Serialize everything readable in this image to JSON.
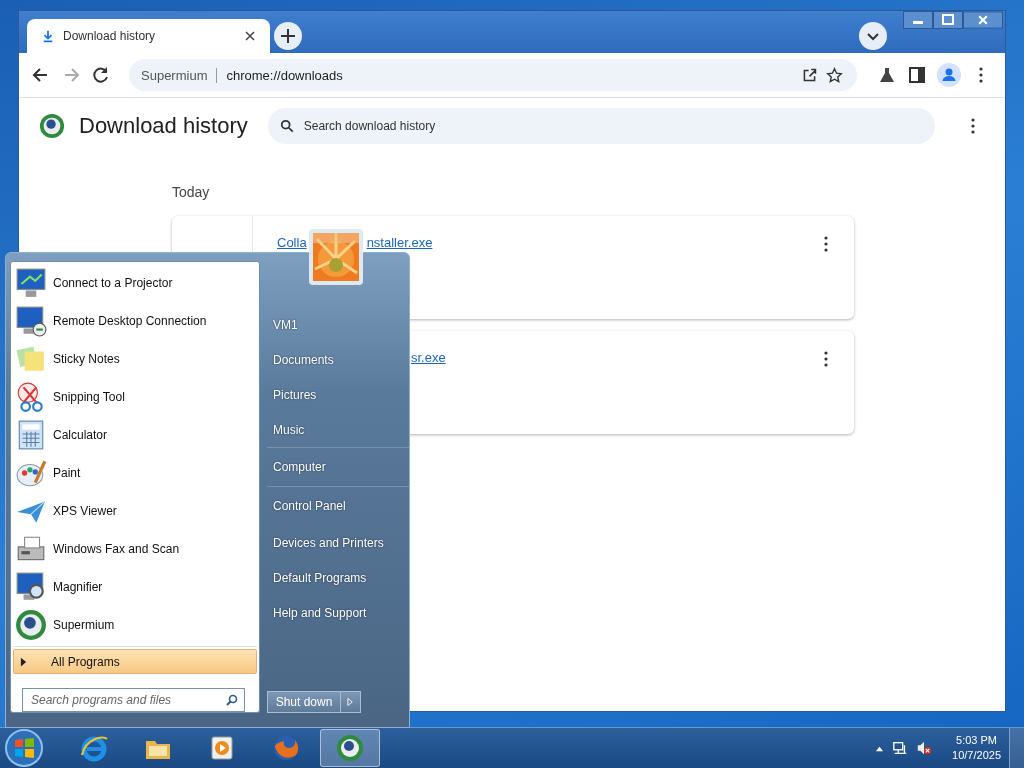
{
  "browser": {
    "tab": {
      "title": "Download history",
      "selected": true
    },
    "address": {
      "site": "Supermium",
      "url": "chrome://downloads"
    }
  },
  "page": {
    "title": "Download history",
    "search": {
      "placeholder": "Search download history"
    },
    "section": "Today",
    "downloads": [
      {
        "link_parts": [
          "Colla",
          "nstaller.exe"
        ]
      },
      {
        "link_parts": [
          "sr.exe"
        ]
      }
    ]
  },
  "start_menu": {
    "programs": [
      {
        "label": "Connect to a Projector",
        "kind": "projector"
      },
      {
        "label": "Remote Desktop Connection",
        "kind": "remote"
      },
      {
        "label": "Sticky Notes",
        "kind": "notes"
      },
      {
        "label": "Snipping Tool",
        "kind": "scissors"
      },
      {
        "label": "Calculator",
        "kind": "calculator"
      },
      {
        "label": "Paint",
        "kind": "palette"
      },
      {
        "label": "XPS Viewer",
        "kind": "plane"
      },
      {
        "label": "Windows Fax and Scan",
        "kind": "fax"
      },
      {
        "label": "Magnifier",
        "kind": "magnifier"
      },
      {
        "label": "Supermium",
        "kind": "globe"
      }
    ],
    "all_programs": "All Programs",
    "search": {
      "placeholder": "Search programs and files"
    },
    "places": [
      [
        "VM1",
        "Documents",
        "Pictures",
        "Music"
      ],
      [
        "Computer"
      ],
      [
        "Control Panel",
        "Devices and Printers",
        "Default Programs",
        "Help and Support"
      ]
    ],
    "shutdown": "Shut down"
  },
  "taskbar": {
    "apps": [
      {
        "kind": "ie",
        "selected": false
      },
      {
        "kind": "folder",
        "selected": false
      },
      {
        "kind": "media",
        "selected": false
      },
      {
        "kind": "firefox",
        "selected": false
      },
      {
        "kind": "globe",
        "selected": true
      }
    ],
    "clock": {
      "time": "5:03 PM",
      "date": "10/7/2025"
    }
  }
}
